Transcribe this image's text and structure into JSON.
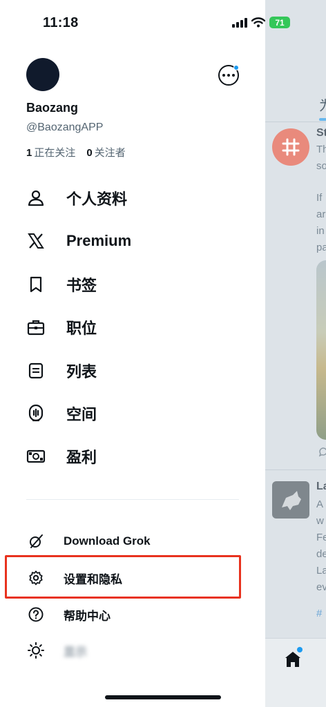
{
  "status_bar": {
    "time": "11:18",
    "battery": "71"
  },
  "profile": {
    "display_name": "Baozang",
    "handle": "@BaozangAPP",
    "following_count": "1",
    "following_label": "正在关注",
    "followers_count": "0",
    "followers_label": "关注者"
  },
  "nav": {
    "items": [
      {
        "label": "个人资料",
        "icon": "person-icon"
      },
      {
        "label": "Premium",
        "icon": "x-logo-icon"
      },
      {
        "label": "书签",
        "icon": "bookmark-icon"
      },
      {
        "label": "职位",
        "icon": "briefcase-icon"
      },
      {
        "label": "列表",
        "icon": "list-icon"
      },
      {
        "label": "空间",
        "icon": "spaces-icon"
      },
      {
        "label": "盈利",
        "icon": "money-icon"
      }
    ]
  },
  "secondary": {
    "items": [
      {
        "label": "Download Grok",
        "icon": "grok-icon"
      },
      {
        "label": "设置和隐私",
        "icon": "gear-icon"
      },
      {
        "label": "帮助中心",
        "icon": "help-icon"
      },
      {
        "label": "显示",
        "icon": "sun-icon"
      }
    ]
  },
  "background": {
    "tab_text": "为",
    "post1_lines": [
      "St",
      "Th",
      "so",
      "",
      "If",
      "ar",
      "in",
      "pa"
    ],
    "post2_lines": [
      "La",
      "A",
      "w",
      "Fe",
      "de",
      "La",
      "ev"
    ],
    "hashtag": "#"
  },
  "colors": {
    "accent": "#1d9bf0",
    "highlight": "#e8321e",
    "battery": "#34c759"
  }
}
